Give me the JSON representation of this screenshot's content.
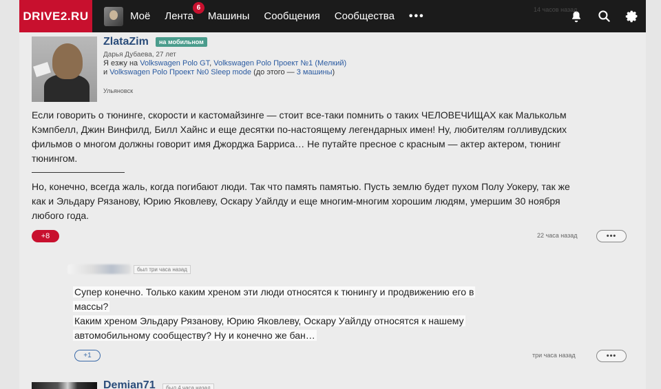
{
  "nav": {
    "logo": "DRIVE2.RU",
    "items": [
      {
        "label": "Моё"
      },
      {
        "label": "Лента",
        "badge": "6"
      },
      {
        "label": "Машины"
      },
      {
        "label": "Сообщения"
      },
      {
        "label": "Сообщества"
      }
    ],
    "more": "•••",
    "ghost_time": "14 часов назад"
  },
  "post": {
    "username": "ZlataZim",
    "mobile_tag": "на мобильном",
    "meta": "Дарья Дубаева, 27 лет",
    "drive_prefix": "Я езжу на ",
    "car1": "Volkswagen Polo GT",
    "sep1": ", ",
    "car2": "Volkswagen Polo Проект №1 (Мелкий)",
    "and": " и ",
    "car3": "Volkswagen Polo Проект №0 Sleep mode",
    "before": " (до этого — ",
    "prev_cars": "3 машины",
    "after": ")",
    "city": "Ульяновск",
    "paragraph1": "Если говорить о тюнинге, скорости и кастомайзинге — стоит все-таки помнить о таких ЧЕЛОВЕЧИЩАХ как Малькольм Кэмпбелл, Джин Винфилд, Билл Хайнс и еще десятки по-настоящему легендарных имен! Ну, любителям голливудских фильмов о многом должны говорит имя Джорджа Барриса… Не путайте пресное с красным — актер актером, тюнинг тюнингом.",
    "paragraph2": "Но, конечно, всегда жаль, когда погибают люди. Так что память памятью. Пусть землю будет пухом Полу Уокеру, так же как и Эльдару Рязанову, Юрию Яковлеву, Оскару Уайлду и еще многим-многим хорошим людям, умершим 30 ноября любого года.",
    "likes": "+8",
    "time": "22 часа назад",
    "more": "•••"
  },
  "comment": {
    "tag": "был три часа назад",
    "line1": "Супер конечно. Только каким хреном эти люди относятся к тюнингу и продвижению его в",
    "line2": "массы?",
    "line3": "Каким хреном Эльдару Рязанову, Юрию Яковлеву, Оскару Уайлду относятся к нашему",
    "line4": "автомобильному сообществу? Ну и конечно же бан…",
    "likes": "+1",
    "time": "три часа назад",
    "more": "•••"
  },
  "next_comment": {
    "username": "Demian71",
    "tag": "был 4 часа назад"
  },
  "colors": {
    "brand": "#c8102e",
    "link": "#2a5aa0",
    "nav_bg": "#1b1b1b",
    "mobile_tag": "#4a9c8c"
  },
  "icons": [
    "bell-icon",
    "search-icon",
    "gear-icon"
  ]
}
